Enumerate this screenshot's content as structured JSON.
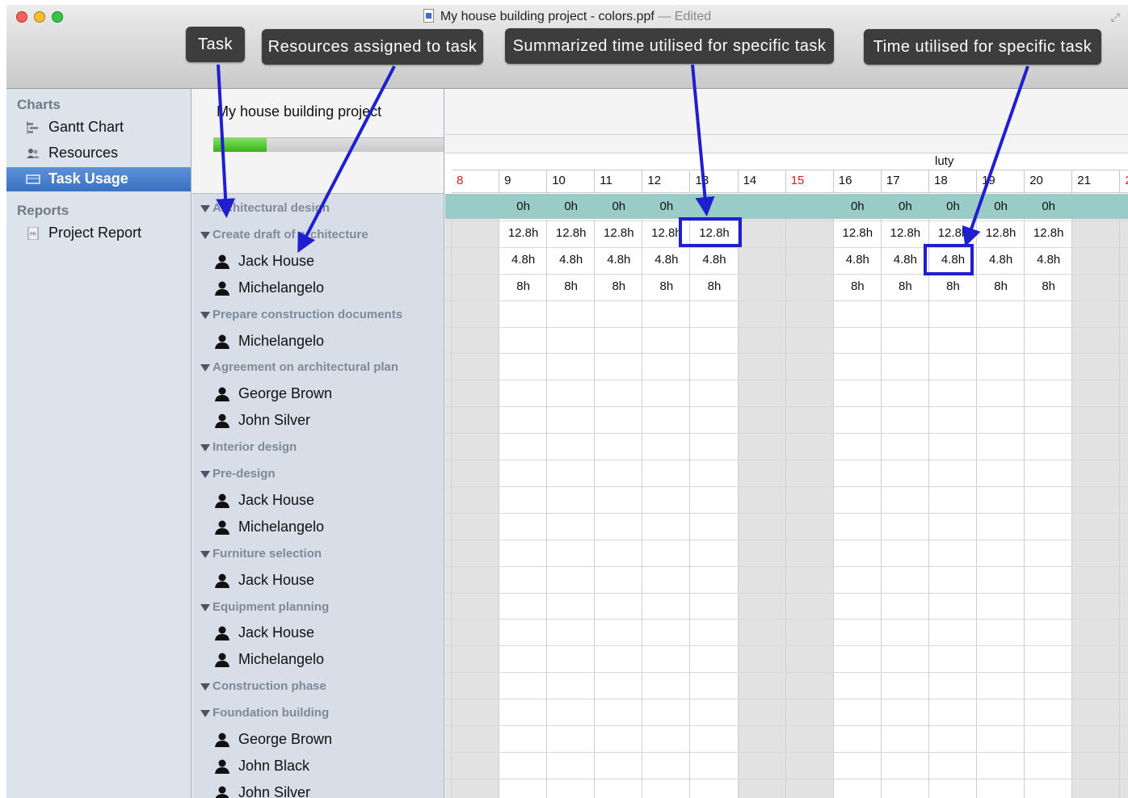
{
  "window": {
    "title": "My house building project - colors.ppf",
    "edited": "— Edited"
  },
  "annotations": {
    "task": "Task",
    "resources": "Resources assigned to task",
    "summarized": "Summarized time utilised for specific task",
    "time": "Time utilised for specific task"
  },
  "sidebar": {
    "charts_header": "Charts",
    "reports_header": "Reports",
    "gantt": "Gantt Chart",
    "resources": "Resources",
    "task_usage": "Task Usage",
    "project_report": "Project Report"
  },
  "project": {
    "name": "My house building project",
    "progress": 0.23
  },
  "rows": [
    {
      "type": "task",
      "label": "Architectural design"
    },
    {
      "type": "task",
      "label": "Create draft of architecture"
    },
    {
      "type": "resource",
      "label": "Jack House"
    },
    {
      "type": "resource",
      "label": "Michelangelo"
    },
    {
      "type": "task",
      "label": "Prepare construction documents"
    },
    {
      "type": "resource",
      "label": "Michelangelo"
    },
    {
      "type": "task",
      "label": "Agreement on architectural plan"
    },
    {
      "type": "resource",
      "label": "George Brown"
    },
    {
      "type": "resource",
      "label": "John Silver"
    },
    {
      "type": "task",
      "label": "Interior design"
    },
    {
      "type": "task",
      "label": "Pre-design"
    },
    {
      "type": "resource",
      "label": "Jack House"
    },
    {
      "type": "resource",
      "label": "Michelangelo"
    },
    {
      "type": "task",
      "label": "Furniture selection"
    },
    {
      "type": "resource",
      "label": "Jack House"
    },
    {
      "type": "task",
      "label": "Equipment planning"
    },
    {
      "type": "resource",
      "label": "Jack House"
    },
    {
      "type": "resource",
      "label": "Michelangelo"
    },
    {
      "type": "task",
      "label": "Construction phase"
    },
    {
      "type": "task",
      "label": "Foundation building"
    },
    {
      "type": "resource",
      "label": "George Brown"
    },
    {
      "type": "resource",
      "label": "John Black"
    },
    {
      "type": "resource",
      "label": "John Silver"
    }
  ],
  "calendar": {
    "month": "luty",
    "days": [
      {
        "d": "8",
        "weekend": true,
        "red": true
      },
      {
        "d": "9",
        "weekend": false,
        "red": false
      },
      {
        "d": "10",
        "weekend": false,
        "red": false
      },
      {
        "d": "11",
        "weekend": false,
        "red": false
      },
      {
        "d": "12",
        "weekend": false,
        "red": false
      },
      {
        "d": "13",
        "weekend": false,
        "red": false
      },
      {
        "d": "14",
        "weekend": true,
        "red": false
      },
      {
        "d": "15",
        "weekend": true,
        "red": true
      },
      {
        "d": "16",
        "weekend": false,
        "red": false
      },
      {
        "d": "17",
        "weekend": false,
        "red": false
      },
      {
        "d": "18",
        "weekend": false,
        "red": false
      },
      {
        "d": "19",
        "weekend": false,
        "red": false
      },
      {
        "d": "20",
        "weekend": false,
        "red": false
      },
      {
        "d": "21",
        "weekend": true,
        "red": false
      },
      {
        "d": "2",
        "weekend": true,
        "red": true
      }
    ]
  },
  "usage": [
    [
      "",
      "0h",
      "0h",
      "0h",
      "0h",
      "",
      "",
      "",
      "0h",
      "0h",
      "0h",
      "0h",
      "0h",
      "",
      ""
    ],
    [
      "",
      "12.8h",
      "12.8h",
      "12.8h",
      "12.8h",
      "12.8h",
      "",
      "",
      "12.8h",
      "12.8h",
      "12.8h",
      "12.8h",
      "12.8h",
      "",
      ""
    ],
    [
      "",
      "4.8h",
      "4.8h",
      "4.8h",
      "4.8h",
      "4.8h",
      "",
      "",
      "4.8h",
      "4.8h",
      "4.8h",
      "4.8h",
      "4.8h",
      "",
      ""
    ],
    [
      "",
      "8h",
      "8h",
      "8h",
      "8h",
      "8h",
      "",
      "",
      "8h",
      "8h",
      "8h",
      "8h",
      "8h",
      "",
      ""
    ]
  ],
  "colors": {
    "summary_row": "#99ccc7",
    "annotation_arrow": "#1f1fd0",
    "selection": "#3a70c2"
  }
}
